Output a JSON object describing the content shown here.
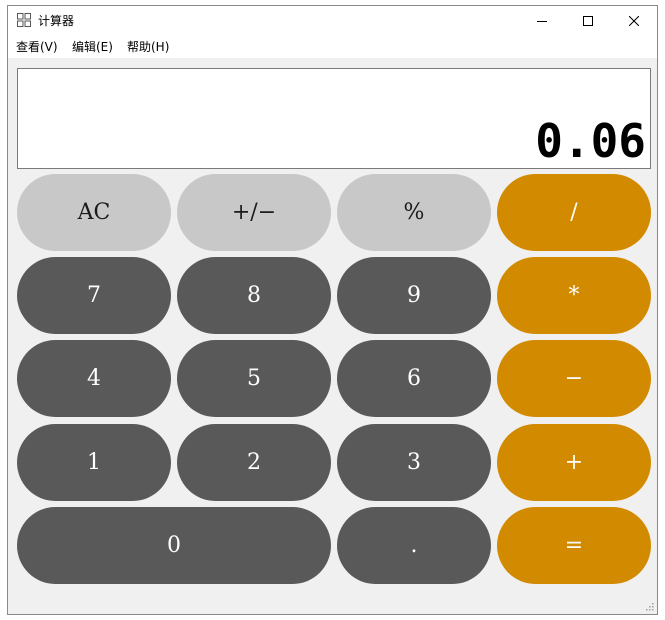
{
  "window": {
    "title": "计算器",
    "icon": "calculator-icon",
    "controls": {
      "minimize": "minimize-icon",
      "maximize": "maximize-icon",
      "close": "close-icon"
    }
  },
  "menu": {
    "view": "查看(V)",
    "edit": "编辑(E)",
    "help": "帮助(H)"
  },
  "display": {
    "value": "0.06"
  },
  "keys": {
    "clear": "AC",
    "sign": "+/−",
    "percent": "%",
    "divide": "/",
    "seven": "7",
    "eight": "8",
    "nine": "9",
    "multiply": "*",
    "four": "4",
    "five": "5",
    "six": "6",
    "subtract": "−",
    "one": "1",
    "two": "2",
    "three": "3",
    "add": "+",
    "zero": "0",
    "decimal": ".",
    "equals": "="
  },
  "colors": {
    "function_key": "#c8c8c8",
    "number_key": "#595959",
    "operator_key": "#d28a00",
    "window_background": "#f0f0f0"
  }
}
